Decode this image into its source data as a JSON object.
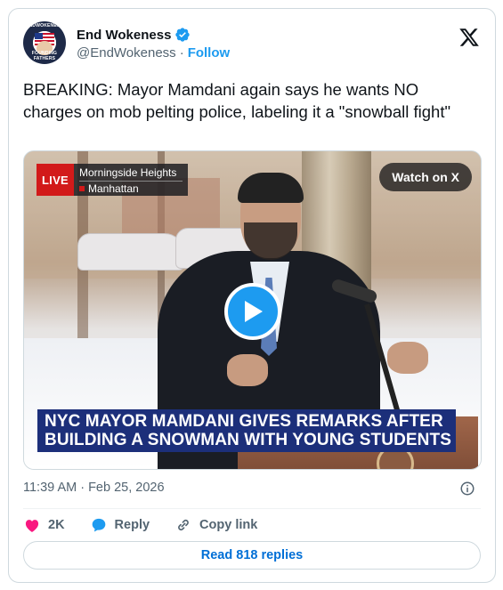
{
  "author": {
    "display_name": "End Wokeness",
    "handle": "@EndWokeness",
    "separator": "·",
    "follow_label": "Follow",
    "verified": true,
    "avatar_text_top": "ENDWOKENESS",
    "avatar_text_bottom": "FOUNDING FATHERS"
  },
  "tweet": {
    "text": "BREAKING: Mayor Mamdani again says he wants NO charges on mob pelting police, labeling it a \"snowball fight\""
  },
  "media": {
    "live_label": "LIVE",
    "location_line1": "Morningside Heights",
    "location_line2": "Manhattan",
    "watch_label": "Watch on X",
    "chyron_line1": "NYC MAYOR MAMDANI GIVES REMARKS AFTER",
    "chyron_line2": "BUILDING A SNOWMAN WITH YOUNG STUDENTS"
  },
  "meta": {
    "timestamp": "11:39 AM · Feb 25, 2026"
  },
  "actions": {
    "like_count": "2K",
    "reply_label": "Reply",
    "copy_link_label": "Copy link"
  },
  "read_replies_label": "Read 818 replies",
  "colors": {
    "accent": "#1d9bf0",
    "like": "#f91880",
    "link": "#006fd6",
    "secondary_text": "#536471",
    "chyron": "#1c2f7a",
    "live": "#d21a1a"
  }
}
